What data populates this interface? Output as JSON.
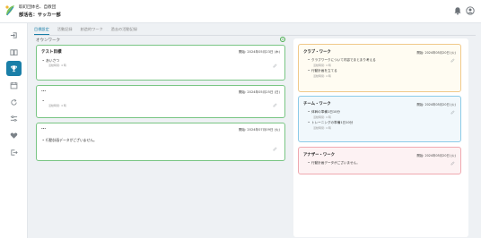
{
  "header": {
    "org_line": "取町団体名、自教団",
    "team_line": "部活名：サッカー部"
  },
  "sidebar": {
    "items": [
      {
        "icon": "login-icon"
      },
      {
        "icon": "book-icon"
      },
      {
        "icon": "trophy-icon",
        "active": true
      },
      {
        "icon": "calendar-icon"
      },
      {
        "icon": "refresh-icon"
      },
      {
        "icon": "sliders-icon"
      },
      {
        "icon": "heart-icon"
      },
      {
        "icon": "logout-icon"
      }
    ]
  },
  "tabs": [
    "目標設定",
    "活動記録",
    "創造的ワーク",
    "過去の活動記録"
  ],
  "section_title": "オウンワーク",
  "left_panels": [
    {
      "title": "テスト目標",
      "date": "開始: 2024年05月23日 (木)",
      "items": [
        {
          "text": "あいさつ",
          "meta": "活動時間: 4 時"
        }
      ]
    },
    {
      "title": "···",
      "date": "開始: 2024年05月25日 (日)",
      "items": [
        {
          "text": "",
          "meta": "活動時間: 4 時"
        }
      ]
    },
    {
      "title": "···",
      "date": "開始: 2024年07月09日 (火)",
      "items": [
        {
          "text": "行動計画データがございません。",
          "meta": ""
        }
      ]
    }
  ],
  "right_panels": [
    {
      "title": "クラブ・ワーク",
      "date": "開始: 2024年05月20日 (火)",
      "bg": "#fffcf2",
      "border": "#f0c98a",
      "items": [
        {
          "text": "クラブワークについて内容でまとまり考える",
          "meta": "活動時間: 4 時"
        },
        {
          "text": "行動計画を立てる",
          "meta": "活動時間: 4 時"
        }
      ]
    },
    {
      "title": "チーム・ワーク",
      "date": "開始: 2024年05月20日 (火)",
      "bg": "#f1f8fc",
      "border": "#8ccbe8",
      "items": [
        {
          "text": "体幹の準備1日10分",
          "meta": "活動時間: 4 時"
        },
        {
          "text": "トレーニングの準備1日10分",
          "meta": "活動時間: 4 時"
        }
      ]
    },
    {
      "title": "アナザー・ワーク",
      "date": "開始: 2024年05月20日 (火)",
      "bg": "#fdf2f3",
      "border": "#f0a9b0",
      "items": [
        {
          "text": "行動計画データがございません。",
          "meta": ""
        }
      ]
    }
  ],
  "colors": {
    "accent": "#1a7fa8",
    "green_border": "#79c584"
  }
}
